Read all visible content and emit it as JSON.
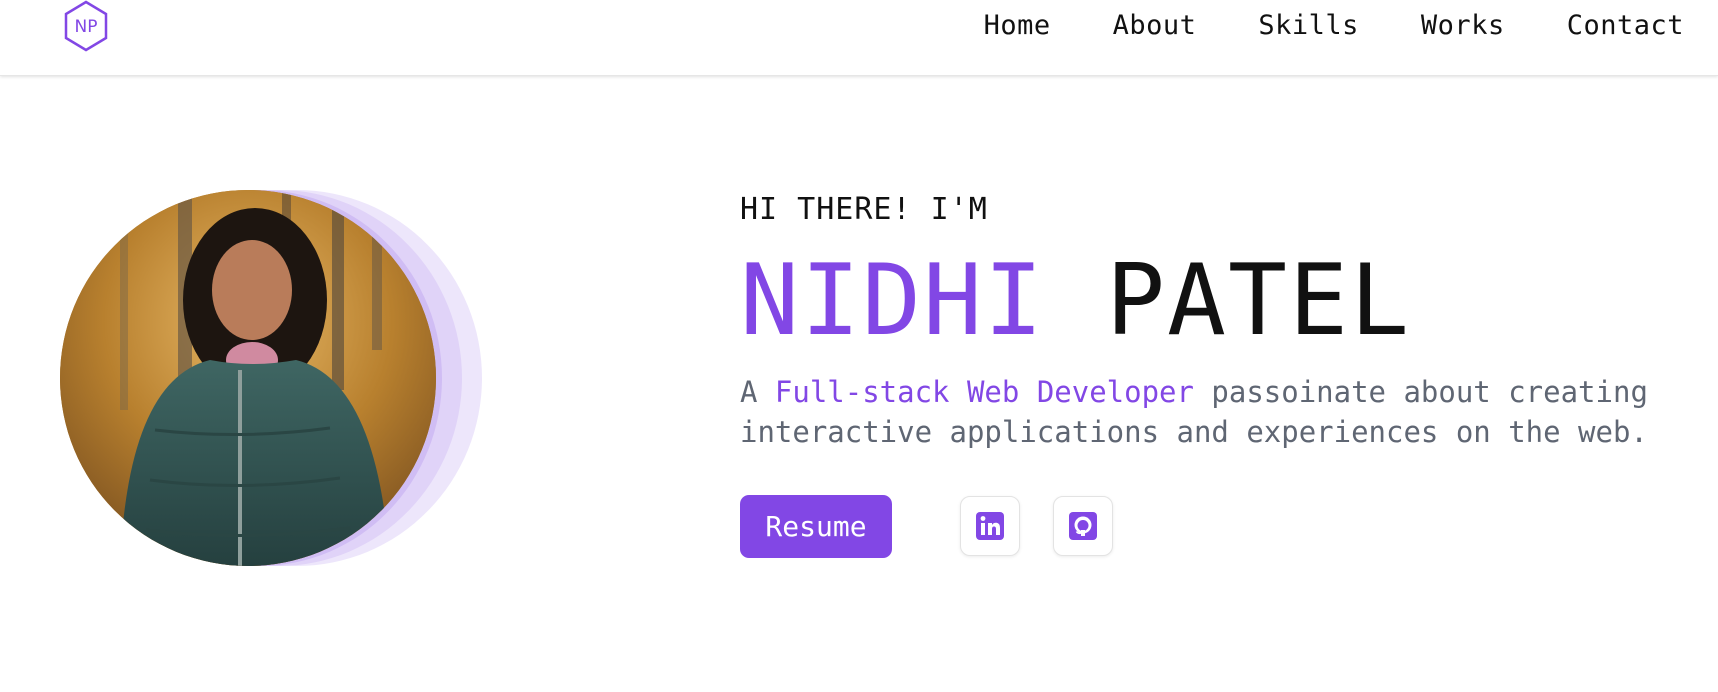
{
  "brand": {
    "logo_text": "NP",
    "accent_color": "#8247e5",
    "logo_icon": "hexagon-monogram-icon"
  },
  "nav": {
    "items": [
      {
        "label": "Home"
      },
      {
        "label": "About"
      },
      {
        "label": "Skills"
      },
      {
        "label": "Works"
      },
      {
        "label": "Contact"
      }
    ]
  },
  "hero": {
    "greeting": "HI THERE! I'M",
    "first_name": "NIDHI",
    "last_name": "PATEL",
    "tagline_prefix": "A ",
    "tagline_highlight": "Full-stack Web Developer",
    "tagline_rest": " passoinate about creating interactive applications and experiences on the web.",
    "resume_label": "Resume",
    "photo_icon": "profile-photo",
    "social": [
      {
        "name": "LinkedIn",
        "icon": "linkedin-icon"
      },
      {
        "name": "GitHub",
        "icon": "github-icon"
      }
    ]
  },
  "colors": {
    "accent": "#8247e5",
    "text": "#111111",
    "muted": "#5f6673"
  }
}
